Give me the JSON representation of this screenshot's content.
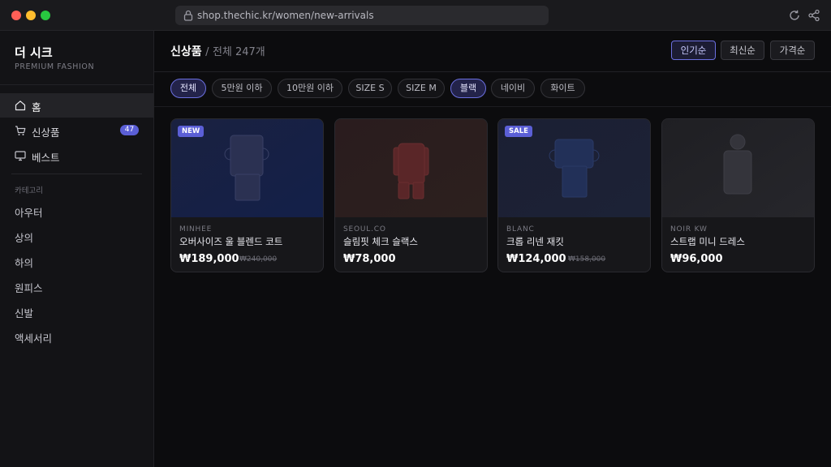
{
  "browser": {
    "url": "shop.thechic.kr/women/new-arrivals"
  },
  "sidebar": {
    "brand": "더 시크",
    "tagline": "PREMIUM FASHION",
    "nav": [
      {
        "label": "홈",
        "icon": "home-icon",
        "active": true
      },
      {
        "label": "신상품",
        "icon": "cart-icon",
        "badge": "47"
      },
      {
        "label": "베스트",
        "icon": "monitor-icon"
      }
    ],
    "section_label": "카테고리",
    "categories": [
      "아우터",
      "상의",
      "하의",
      "원피스",
      "신발",
      "액세서리"
    ]
  },
  "main": {
    "title": "신상품",
    "separator": "/",
    "subtitle": "전체 247개",
    "sort": [
      {
        "label": "인기순",
        "active": true
      },
      {
        "label": "최신순"
      },
      {
        "label": "가격순"
      }
    ],
    "filters": [
      {
        "label": "전체",
        "active": true
      },
      {
        "label": "5만원 이하"
      },
      {
        "label": "10만원 이하"
      },
      {
        "label": "SIZE S"
      },
      {
        "label": "SIZE M"
      },
      {
        "label": "블랙",
        "active": true
      },
      {
        "label": "네이비"
      },
      {
        "label": "화이트"
      }
    ],
    "products": [
      {
        "brand": "MINHEE",
        "name": "오버사이즈 울 블렌드 코트",
        "price": "₩189,000",
        "original_price": "₩240,000",
        "tag": "NEW"
      },
      {
        "brand": "SEOUL.CO",
        "name": "슬림핏 체크 슬랙스",
        "price": "₩78,000"
      },
      {
        "brand": "BLANC",
        "name": "크롭 리넨 재킷",
        "price": "₩124,000",
        "original_price": "₩158,000",
        "tag": "SALE"
      },
      {
        "brand": "NOIR KW",
        "name": "스트랩 미니 드레스",
        "price": "₩96,000"
      }
    ]
  },
  "colors": {
    "accent": "#5b5fd6",
    "background": "#0c0c0e",
    "sidebar": "#131316"
  }
}
